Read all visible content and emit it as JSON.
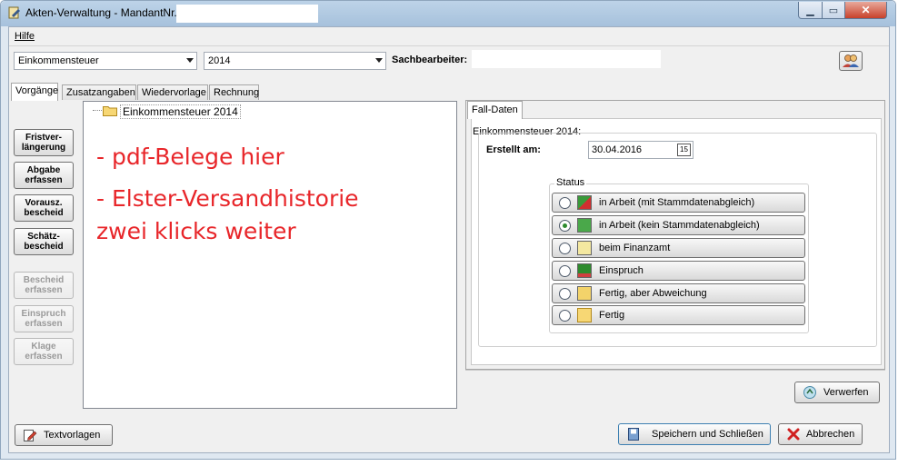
{
  "window": {
    "title": "Akten-Verwaltung - MandantNr.:",
    "controls": {
      "minimize": "▁",
      "maximize": "▭",
      "close": "✕"
    }
  },
  "menu": {
    "help": "Hilfe"
  },
  "toolbar": {
    "tax_type": "Einkommensteuer",
    "year": "2014",
    "clerk_label": "Sachbearbeiter:",
    "clerk_value": ""
  },
  "tabs": [
    "Vorgänge",
    "Zusatzangaben",
    "Wiedervorlage",
    "Rechnung"
  ],
  "sidebar": [
    {
      "line1": "Fristver-",
      "line2": "längerung",
      "enabled": true
    },
    {
      "line1": "Abgabe",
      "line2": "erfassen",
      "enabled": true
    },
    {
      "line1": "Vorausz.",
      "line2": "bescheid",
      "enabled": true
    },
    {
      "line1": "Schätz-",
      "line2": "bescheid",
      "enabled": true
    },
    {
      "line1": "Bescheid",
      "line2": "erfassen",
      "enabled": false
    },
    {
      "line1": "Einspruch",
      "line2": "erfassen",
      "enabled": false
    },
    {
      "line1": "Klage",
      "line2": "erfassen",
      "enabled": false
    }
  ],
  "tree": {
    "root_label": "Einkommensteuer 2014"
  },
  "annotations": {
    "line1": "- pdf-Belege hier",
    "line2": "- Elster-Versandhistorie",
    "line3": "zwei klicks weiter"
  },
  "case": {
    "tab": "Fall-Daten",
    "group_title": "Einkommensteuer 2014:",
    "created_label": "Erstellt am:",
    "created_value": "30.04.2016",
    "calendar_icon": "15",
    "status_title": "Status",
    "statuses": [
      {
        "label": "in Arbeit (mit Stammdatenabgleich)",
        "selected": false,
        "icon": "work-sync-icon"
      },
      {
        "label": "in Arbeit (kein Stammdatenabgleich)",
        "selected": true,
        "icon": "work-icon"
      },
      {
        "label": "beim Finanzamt",
        "selected": false,
        "icon": "tax-office-icon"
      },
      {
        "label": "Einspruch",
        "selected": false,
        "icon": "objection-icon"
      },
      {
        "label": "Fertig, aber Abweichung",
        "selected": false,
        "icon": "deviation-icon"
      },
      {
        "label": "Fertig",
        "selected": false,
        "icon": "done-folder-icon"
      }
    ]
  },
  "buttons": {
    "discard": "Verwerfen",
    "templates": "Textvorlagen",
    "save_close": "Speichern und Schließen",
    "cancel": "Abbrechen"
  }
}
